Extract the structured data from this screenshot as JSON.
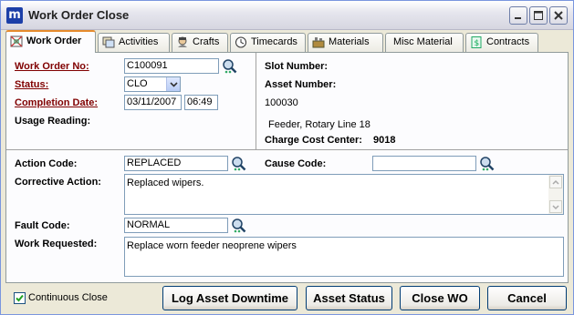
{
  "window": {
    "title": "Work Order Close",
    "app_icon_letter": "m"
  },
  "tabs": [
    {
      "label": "Work Order",
      "icon": "work-order-icon",
      "active": true
    },
    {
      "label": "Activities",
      "icon": "activities-icon"
    },
    {
      "label": "Crafts",
      "icon": "crafts-icon"
    },
    {
      "label": "Timecards",
      "icon": "clock-icon"
    },
    {
      "label": "Materials",
      "icon": "materials-icon"
    },
    {
      "label": "Misc Material",
      "icon": ""
    },
    {
      "label": "Contracts",
      "icon": "contracts-icon"
    }
  ],
  "left": {
    "work_order_no": {
      "label": "Work Order No:",
      "value": "C100091"
    },
    "status": {
      "label": "Status:",
      "value": "CLO"
    },
    "completion_date": {
      "label": "Completion Date:",
      "date": "03/11/2007",
      "time": "06:49"
    },
    "usage_reading": {
      "label": "Usage Reading:"
    }
  },
  "right": {
    "slot_number": {
      "label": "Slot Number:"
    },
    "asset_number": {
      "label": "Asset Number:",
      "value": "100030"
    },
    "asset_description": "Feeder, Rotary Line 18",
    "charge_cost_center": {
      "label": "Charge Cost Center:",
      "value": "9018"
    }
  },
  "bottom": {
    "action_code": {
      "label": "Action Code:",
      "value": "REPLACED"
    },
    "cause_code": {
      "label": "Cause Code:",
      "value": ""
    },
    "corrective_action": {
      "label": "Corrective Action:",
      "value": "Replaced wipers."
    },
    "fault_code": {
      "label": "Fault Code:",
      "value": "NORMAL"
    },
    "work_requested": {
      "label": "Work Requested:",
      "value": "Replace worn feeder neoprene wipers"
    }
  },
  "footer": {
    "continuous_close": {
      "label": "Continuous Close",
      "checked": true
    },
    "buttons": {
      "log_asset_downtime": "Log Asset Downtime",
      "asset_status": "Asset Status",
      "close_wo": "Close WO",
      "cancel": "Cancel"
    }
  },
  "colors": {
    "link_label": "#800000",
    "active_tab_accent": "#e68b2c",
    "field_border": "#7f9db9"
  }
}
